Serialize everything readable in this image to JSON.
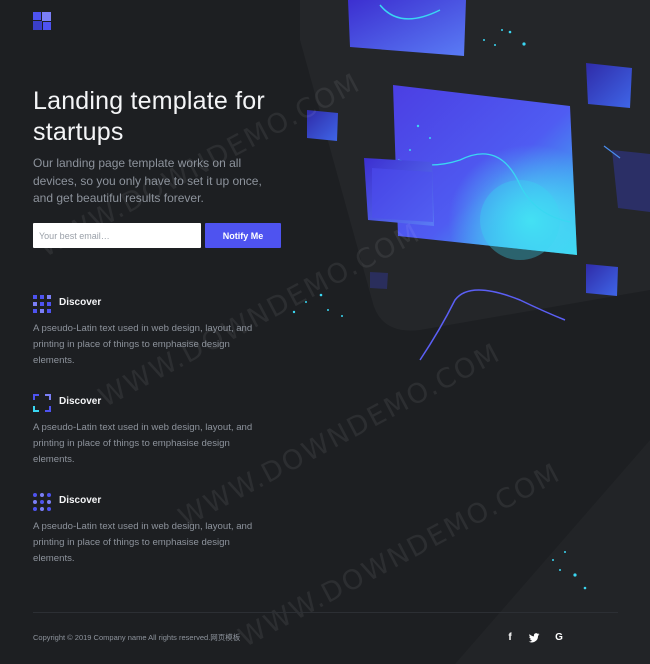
{
  "hero": {
    "title": "Landing template for startups",
    "paragraph": "Our landing page template works on all devices, so you only have to set it up once, and get beautiful results forever.",
    "email_placeholder": "Your best email…",
    "button_label": "Notify Me"
  },
  "features": [
    {
      "icon": "grid-dots-icon",
      "title": "Discover",
      "text": "A pseudo-Latin text used in web design, layout, and printing in place of things to emphasise design elements."
    },
    {
      "icon": "focus-frame-icon",
      "title": "Discover",
      "text": "A pseudo-Latin text used in web design, layout, and printing in place of things to emphasise design elements."
    },
    {
      "icon": "dots-matrix-icon",
      "title": "Discover",
      "text": "A pseudo-Latin text used in web design, layout, and printing in place of things to emphasise design elements."
    }
  ],
  "footer": {
    "copyright": "Copyright © 2019 Company name All rights reserved.网页模板",
    "social": [
      {
        "icon": "facebook-icon",
        "glyph": "f"
      },
      {
        "icon": "twitter-icon",
        "glyph": "🐦"
      },
      {
        "icon": "google-icon",
        "glyph": "G"
      }
    ]
  },
  "watermark": "WWW.DOWNDEMO.COM",
  "colors": {
    "background": "#1d1f22",
    "accent": "#4e53f0",
    "text_muted": "#8d939c"
  }
}
